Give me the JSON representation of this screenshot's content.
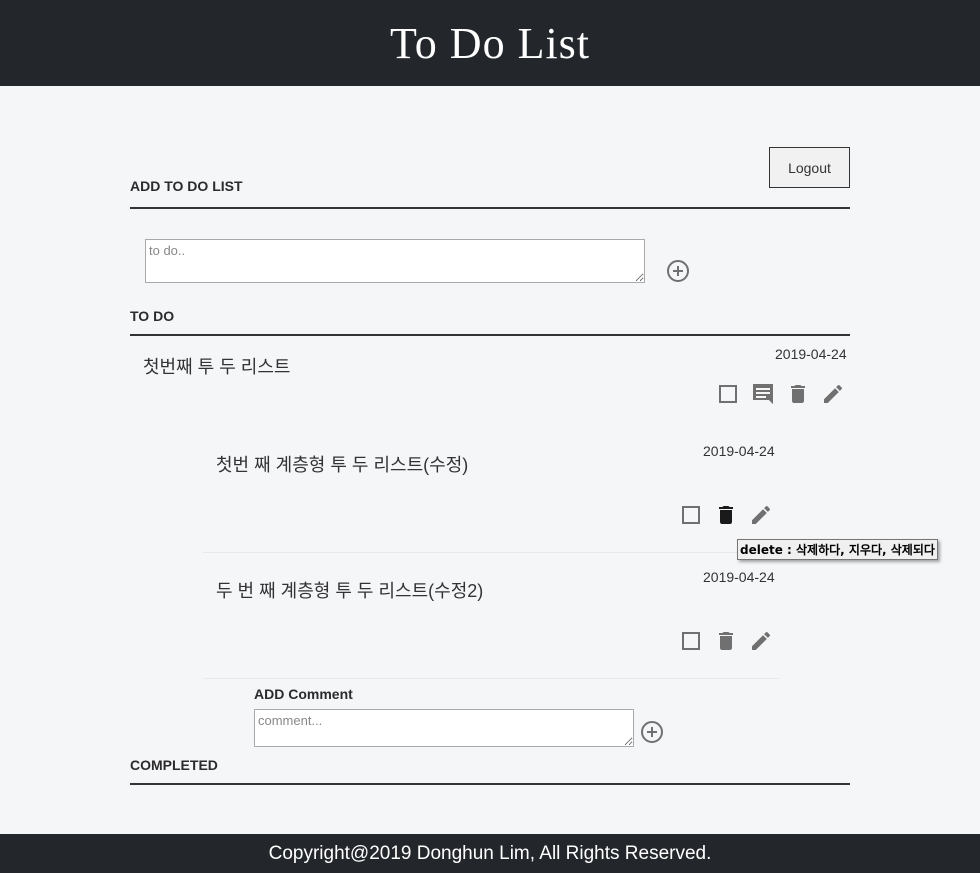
{
  "app": {
    "title": "To Do List"
  },
  "auth": {
    "logout_label": "Logout"
  },
  "add_section": {
    "title": "ADD TO DO LIST",
    "placeholder": "to do..",
    "value": ""
  },
  "todo_section": {
    "title": "TO DO",
    "items": [
      {
        "text": "첫번째 투 두 리스트",
        "date": "2019-04-24",
        "children": [
          {
            "text": "첫번 째 계층형 투 두 리스트(수정)",
            "date": "2019-04-24"
          },
          {
            "text": "두 번 째 계층형 투 두 리스트(수정2)",
            "date": "2019-04-24"
          }
        ]
      }
    ]
  },
  "comment_section": {
    "title": "ADD Comment",
    "placeholder": "comment...",
    "value": ""
  },
  "tooltip": {
    "text": "delete : 삭제하다, 지우다, 삭제되다"
  },
  "completed_section": {
    "title": "COMPLETED"
  },
  "footer": {
    "text": "Copyright@2019 Donghun Lim, All Rights Reserved."
  },
  "colors": {
    "header_bg": "#23272b",
    "page_bg": "#f5f6f8",
    "icon_gray": "#707070",
    "icon_active": "#1a1a1a"
  },
  "icons": [
    "checkbox-icon",
    "comment-icon",
    "trash-icon",
    "pencil-icon",
    "plus-circle-icon"
  ]
}
